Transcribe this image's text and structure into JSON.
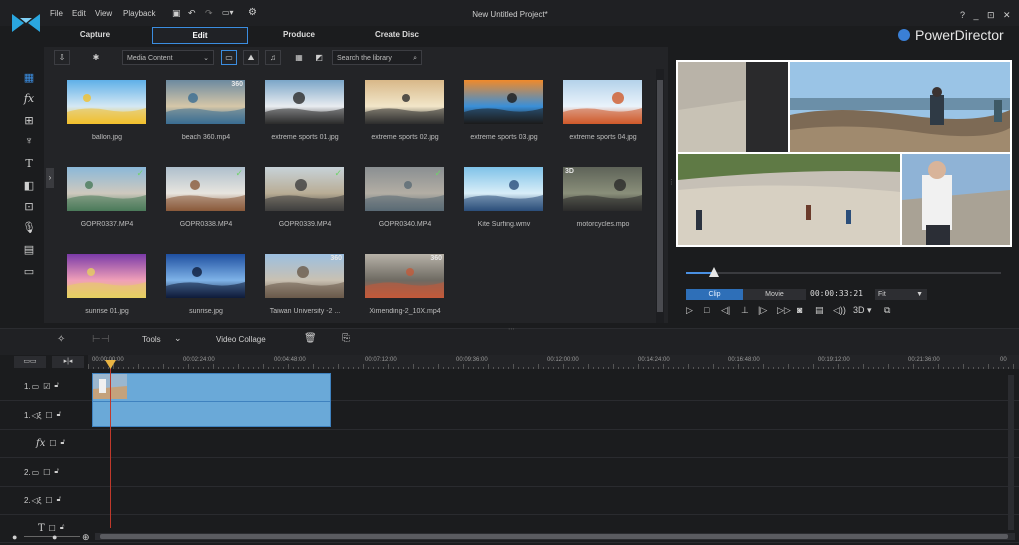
{
  "menu": [
    "File",
    "Edit",
    "View",
    "Playback"
  ],
  "project_title": "New Untitled Project*",
  "window_controls": "? _ ⊡ ✕",
  "tabs": [
    {
      "label": "Capture"
    },
    {
      "label": "Edit",
      "active": true
    },
    {
      "label": "Produce"
    },
    {
      "label": "Create Disc"
    }
  ],
  "brand": {
    "name": "PowerDirector",
    "color": "#3a7fd5"
  },
  "library": {
    "filter_value": "Media Content",
    "search_placeholder": "Search the library",
    "items": [
      {
        "caption": "ballon.jpg",
        "badge": "",
        "checked": false,
        "icon": "balloon-photo"
      },
      {
        "caption": "beach 360.mp4",
        "badge": "360",
        "checked": false,
        "icon": "beach-photo"
      },
      {
        "caption": "extreme sports 01.jpg",
        "badge": "",
        "checked": false,
        "icon": "bmx-photo"
      },
      {
        "caption": "extreme sports 02.jpg",
        "badge": "",
        "checked": false,
        "icon": "motocross-photo"
      },
      {
        "caption": "extreme sports 03.jpg",
        "badge": "",
        "checked": false,
        "icon": "skater-photo"
      },
      {
        "caption": "extreme sports 04.jpg",
        "badge": "",
        "checked": false,
        "icon": "skydiver-photo"
      },
      {
        "caption": "GOPR0337.MP4",
        "badge": "",
        "checked": true,
        "icon": "beach-video"
      },
      {
        "caption": "GOPR0338.MP4",
        "badge": "",
        "checked": true,
        "icon": "kid-video"
      },
      {
        "caption": "GOPR0339.MP4",
        "badge": "",
        "checked": true,
        "icon": "shore-video"
      },
      {
        "caption": "GOPR0340.MP4",
        "badge": "",
        "checked": true,
        "icon": "rocks-video"
      },
      {
        "caption": "Kite Surfing.wmv",
        "badge": "",
        "checked": false,
        "icon": "kite-video"
      },
      {
        "caption": "motorcycles.mpo",
        "badge": "3D",
        "checked": false,
        "icon": "motorcycles-photo"
      },
      {
        "caption": "sunrise 01.jpg",
        "badge": "",
        "checked": false,
        "icon": "sunrise-photo"
      },
      {
        "caption": "sunrise.jpg",
        "badge": "",
        "checked": false,
        "icon": "sunrise-blue-photo"
      },
      {
        "caption": "Taiwan University -2 ...",
        "badge": "360",
        "checked": false,
        "icon": "campus-photo"
      },
      {
        "caption": "Ximending-2_10X.mp4",
        "badge": "360",
        "checked": false,
        "icon": "street-video"
      }
    ]
  },
  "preview": {
    "mode_clip": "Clip",
    "mode_movie": "Movie",
    "timecode": "00:00:33:21",
    "zoom": "Fit",
    "playback_buttons": [
      "play-icon",
      "stop-icon",
      "prev-frame-icon",
      "split-icon",
      "next-frame-icon",
      "fast-forward-icon",
      "snapshot-icon",
      "subtitle-icon",
      "volume-icon"
    ],
    "three_d": "3D",
    "scrub_progress": 0.09
  },
  "timeline_toolbar": {
    "tools": "Tools",
    "video_collage": "Video Collage"
  },
  "ruler_labels": [
    "00:00:00:00",
    "00:02:24:00",
    "00:04:48:00",
    "00:07:12:00",
    "00:09:36:00",
    "00:12:00:00",
    "00:14:24:00",
    "00:16:48:00",
    "00:19:12:00",
    "00:21:36:00",
    "00"
  ],
  "tracks": [
    {
      "label": "1.",
      "kind": "video-track-icon"
    },
    {
      "label": "1.",
      "kind": "audio-track-icon"
    },
    {
      "label": "fx",
      "kind": "fx-track-icon"
    },
    {
      "label": "2.",
      "kind": "video-track-icon"
    },
    {
      "label": "2.",
      "kind": "audio-track-icon"
    },
    {
      "label": "T",
      "kind": "title-track-icon"
    }
  ],
  "colors": {
    "accent": "#3b8de0",
    "clip": "#6aa9d8",
    "playhead": "#c0392b",
    "check": "#6fd36a"
  }
}
